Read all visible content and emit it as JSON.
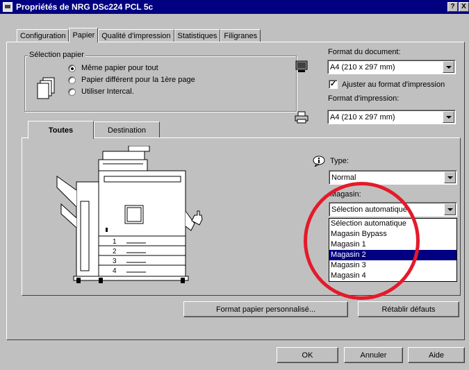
{
  "window": {
    "title": "Propriétés de NRG DSc224 PCL 5c",
    "help_label": "?",
    "close_label": "X"
  },
  "tabs": [
    {
      "label": "Configuration"
    },
    {
      "label": "Papier"
    },
    {
      "label": "Qualité d'impression"
    },
    {
      "label": "Statistiques"
    },
    {
      "label": "Filigranes"
    }
  ],
  "paper_selection": {
    "legend": "Sélection papier",
    "options": [
      {
        "label": "Même papier pour tout"
      },
      {
        "label": "Papier différent pour la 1ère page"
      },
      {
        "label": "Utiliser Intercal."
      }
    ]
  },
  "document": {
    "format_label": "Format du document:",
    "format_value": "A4 (210 x 297 mm)",
    "fit_label": "Ajuster au format d'impression",
    "fit_check": "✓",
    "print_format_label": "Format d'impression:",
    "print_format_value": "A4 (210 x 297 mm)"
  },
  "inner_tabs": [
    {
      "label": "Toutes"
    },
    {
      "label": "Destination"
    }
  ],
  "printer_trays": [
    "1",
    "2",
    "3",
    "4"
  ],
  "type": {
    "label": "Type:",
    "value": "Normal"
  },
  "tray": {
    "label": "Magasin:",
    "value": "Sélection automatique",
    "options": [
      {
        "label": "Sélection automatique"
      },
      {
        "label": "Magasin Bypass"
      },
      {
        "label": "Magasin 1"
      },
      {
        "label": "Magasin 2"
      },
      {
        "label": "Magasin 3"
      },
      {
        "label": "Magasin 4"
      }
    ]
  },
  "buttons": {
    "custom_paper": "Format papier personnalisé...",
    "restore_defaults": "Rétablir défauts",
    "ok": "OK",
    "cancel": "Annuler",
    "help": "Aide"
  }
}
